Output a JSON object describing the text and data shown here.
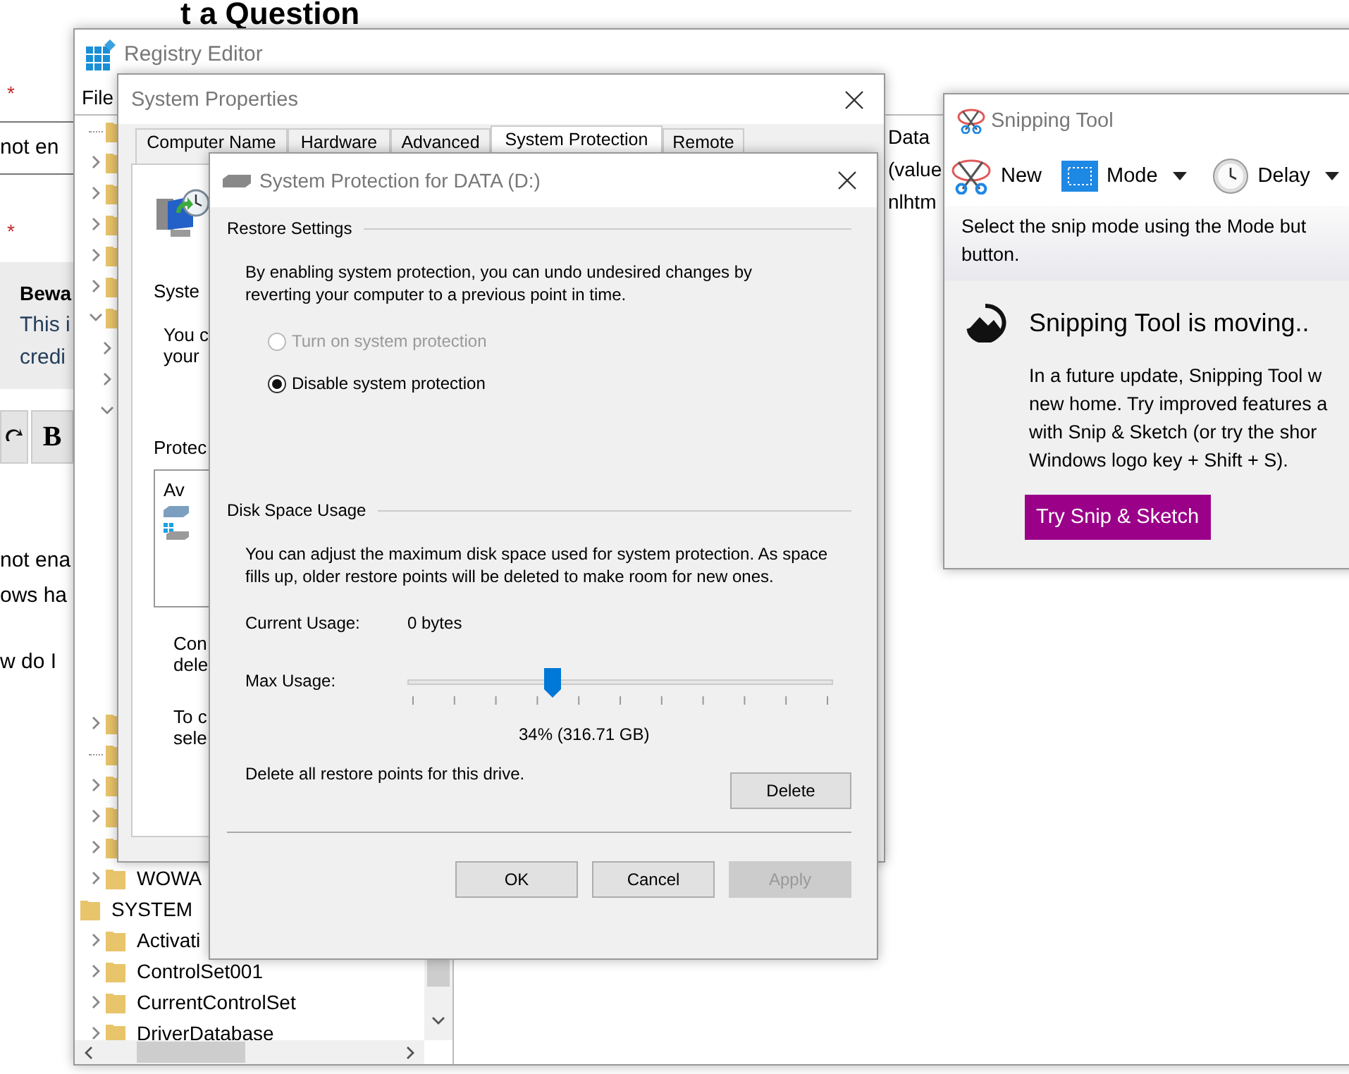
{
  "web_page": {
    "heading": "t a Question",
    "required_marks": [
      "*",
      "*"
    ],
    "field_value": "not en",
    "notice": {
      "title": "Bewa",
      "lines": [
        "This i",
        "credi"
      ]
    },
    "editor_toolbar": [
      {
        "kind": "redo"
      },
      {
        "kind": "bold",
        "label": "B"
      }
    ],
    "body_paragraphs": [
      [
        "not ena",
        "ows ha"
      ],
      [
        "w do I"
      ]
    ]
  },
  "registry_editor": {
    "title": "Registry Editor",
    "menu": [
      "File"
    ],
    "tree": {
      "upper_rows": [
        {
          "expandable": false
        },
        {
          "expandable": true,
          "expanded": false
        },
        {
          "expandable": true,
          "expanded": false
        },
        {
          "expandable": true,
          "expanded": false
        },
        {
          "expandable": true,
          "expanded": false
        },
        {
          "expandable": true,
          "expanded": false
        },
        {
          "expandable": true,
          "expanded": true,
          "children": [
            {
              "expandable": true,
              "expanded": false
            },
            {
              "expandable": true,
              "expanded": false
            },
            {
              "expandable": true,
              "expanded": true
            }
          ]
        }
      ],
      "lower_rows": [
        {
          "expandable": true,
          "expanded": false
        },
        {
          "expandable": false
        },
        {
          "expandable": true,
          "expanded": false
        },
        {
          "expandable": true,
          "expanded": false
        },
        {
          "expandable": true,
          "expanded": false
        },
        {
          "label": "WOWA",
          "expandable": true,
          "expanded": false
        }
      ],
      "roots": [
        {
          "label": "SYSTEM",
          "children": [
            {
              "label": "Activati",
              "expandable": true,
              "expanded": false
            },
            {
              "label": "ControlSet001",
              "expandable": true,
              "expanded": false
            },
            {
              "label": "CurrentControlSet",
              "expandable": true,
              "expanded": false
            },
            {
              "label": "DriverDatabase",
              "expandable": true,
              "expanded": false
            }
          ]
        }
      ]
    },
    "values_column_header": "Data",
    "values": [
      "(value",
      "nlhtm"
    ]
  },
  "system_properties": {
    "title": "System Properties",
    "tabs": [
      {
        "label": "Computer Name",
        "selected": false
      },
      {
        "label": "Hardware",
        "selected": false
      },
      {
        "label": "Advanced",
        "selected": false
      },
      {
        "label": "System Protection",
        "selected": true
      },
      {
        "label": "Remote",
        "selected": false
      }
    ],
    "heading": "Syste",
    "intro_lines": [
      "You c",
      "your"
    ],
    "protection_label": "Protec",
    "drives_header": "Av",
    "configure_lines": [
      "Con",
      "dele"
    ],
    "create_lines": [
      "To c",
      "sele"
    ]
  },
  "protection_dialog": {
    "title": "System Protection for DATA (D:)",
    "restore_settings": {
      "heading": "Restore Settings",
      "description": "By enabling system protection, you can undo undesired changes by reverting your computer to a previous point in time.",
      "options": [
        {
          "label": "Turn on system protection",
          "selected": false,
          "disabled": true
        },
        {
          "label": "Disable system protection",
          "selected": true,
          "disabled": false
        }
      ]
    },
    "disk_space": {
      "heading": "Disk Space Usage",
      "description": "You can adjust the maximum disk space used for system protection. As space fills up, older restore points will be deleted to make room for new ones.",
      "current_usage_label": "Current Usage:",
      "current_usage": "0 bytes",
      "max_usage_label": "Max Usage:",
      "max_usage": {
        "level": 0.34
      },
      "max_usage_reading": "34% (316.71 GB)",
      "delete_text": "Delete all restore points for this drive.",
      "delete_button": "Delete"
    },
    "buttons": [
      {
        "label": "OK",
        "disabled": false
      },
      {
        "label": "Cancel",
        "disabled": false
      },
      {
        "label": "Apply",
        "disabled": true
      }
    ]
  },
  "snipping_tool": {
    "title": "Snipping Tool",
    "toolbar": [
      {
        "kind": "new",
        "label": "New"
      },
      {
        "kind": "mode",
        "label": "Mode"
      },
      {
        "kind": "delay",
        "label": "Delay"
      }
    ],
    "hint_lines": [
      "Select the snip mode using the Mode but",
      "button."
    ],
    "notice_heading": "Snipping Tool is moving..",
    "notice_lines": [
      "In a future update, Snipping Tool w",
      "new home. Try improved features a",
      "with Snip & Sketch (or try the shor",
      "Windows logo key + Shift + S)."
    ],
    "action_button": "Try Snip & Sketch"
  }
}
